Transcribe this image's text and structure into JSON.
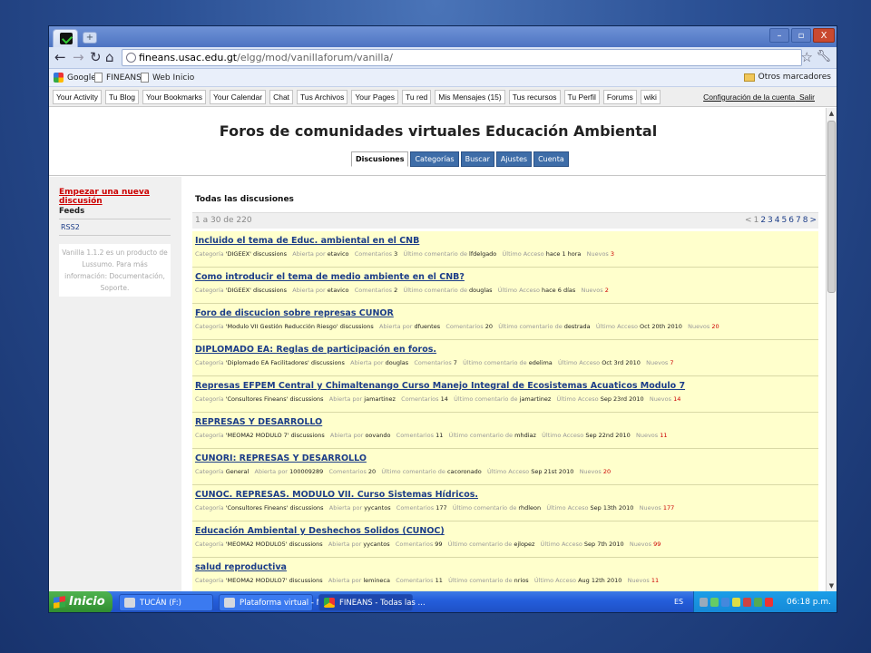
{
  "browser": {
    "url_host": "fineans.usac.edu.gt",
    "url_path": "/elgg/mod/vanillaforum/vanilla/",
    "window_controls": [
      "–",
      "▫",
      "X"
    ]
  },
  "bookmarks": [
    "Google",
    "FINEANS",
    "Web Inicio"
  ],
  "other_bookmarks": "Otros marcadores",
  "site_toolbar": {
    "links": [
      "Your Activity",
      "Tu Blog",
      "Your Bookmarks",
      "Your Calendar",
      "Chat",
      "Tus Archivos",
      "Your Pages",
      "Tu red",
      "Mis Mensajes (15)",
      "Tus recursos",
      "Tu Perfil",
      "Forums",
      "wiki"
    ],
    "account_settings": "Configuración de la cuenta",
    "logout": "Salir"
  },
  "forum": {
    "title": "Foros de comunidades virtuales Educación Ambiental",
    "tabs": [
      "Discusiones",
      "Categorías",
      "Buscar",
      "Ajustes",
      "Cuenta"
    ],
    "active_tab": "Discusiones"
  },
  "sidebar": {
    "new_discussion": "Empezar una nueva discusión",
    "feeds_label": "Feeds",
    "rss": "RSS2",
    "vanilla_note": "Vanilla 1.1.2 es un producto de Lussumo. Para más información: Documentación, Soporte."
  },
  "main": {
    "heading": "Todas las discusiones",
    "count": "1 a 30 de 220",
    "pager": [
      "<",
      "1",
      "2",
      "3",
      "4",
      "5",
      "6",
      "7",
      "8",
      ">"
    ]
  },
  "labels": {
    "category": "Categoría",
    "opened_by": "Abierta por",
    "comments": "Comentarios",
    "last_comment": "Último comentario de",
    "last_access": "Último Acceso",
    "new": "Nuevos"
  },
  "threads": [
    {
      "title": "Incluido el tema de Educ. ambiental en el CNB",
      "category": "'DIGEEX' discussions",
      "author": "etavico",
      "comments": "3",
      "last": "lfdelgado",
      "access": "hace 1 hora",
      "new": "3"
    },
    {
      "title": "Como introducir el tema de medio ambiente en el CNB?",
      "category": "'DIGEEX' discussions",
      "author": "etavico",
      "comments": "2",
      "last": "douglas",
      "access": "hace 6 días",
      "new": "2"
    },
    {
      "title": "Foro de discucion sobre represas CUNOR",
      "category": "'Modulo VII Gestión Reducción Riesgo' discussions",
      "author": "dfuentes",
      "comments": "20",
      "last": "destrada",
      "access": "Oct 20th 2010",
      "new": "20"
    },
    {
      "title": "DIPLOMADO EA: Reglas de participación en foros.",
      "category": "'Diplomado EA Facilitadores' discussions",
      "author": "douglas",
      "comments": "7",
      "last": "edelima",
      "access": "Oct 3rd 2010",
      "new": "7"
    },
    {
      "title": "Represas EFPEM Central y Chimaltenango Curso Manejo Integral de Ecosistemas Acuaticos Modulo 7",
      "category": "'Consultores Fineans' discussions",
      "author": "jamartinez",
      "comments": "14",
      "last": "jamartinez",
      "access": "Sep 23rd 2010",
      "new": "14"
    },
    {
      "title": "REPRESAS Y DESARROLLO",
      "category": "'MEOMA2 MODULO 7' discussions",
      "author": "oovando",
      "comments": "11",
      "last": "mhdiaz",
      "access": "Sep 22nd 2010",
      "new": "11"
    },
    {
      "title": "CUNORI: REPRESAS Y DESARROLLO",
      "category": "General",
      "author": "100009289",
      "comments": "20",
      "last": "cacoronado",
      "access": "Sep 21st 2010",
      "new": "20"
    },
    {
      "title": "CUNOC. REPRESAS. MODULO VII. Curso Sistemas Hídricos.",
      "category": "'Consultores Fineans' discussions",
      "author": "yycantos",
      "comments": "177",
      "last": "rhdleon",
      "access": "Sep 13th 2010",
      "new": "177"
    },
    {
      "title": "Educación Ambiental y Deshechos Solidos (CUNOC)",
      "category": "'MEOMA2 MODULO5' discussions",
      "author": "yycantos",
      "comments": "99",
      "last": "ejlopez",
      "access": "Sep 7th 2010",
      "new": "99"
    },
    {
      "title": "salud reproductiva",
      "category": "'MEOMA2 MODULO7' discussions",
      "author": "lemineca",
      "comments": "11",
      "last": "nrios",
      "access": "Aug 12th 2010",
      "new": "11"
    }
  ],
  "taskbar": {
    "start": "Inicio",
    "buttons": [
      "TUCÁN (F:)",
      "Plataforma virtual - M...",
      "FINEANS - Todas las ..."
    ],
    "lang": "ES",
    "clock": "06:18 p.m."
  }
}
